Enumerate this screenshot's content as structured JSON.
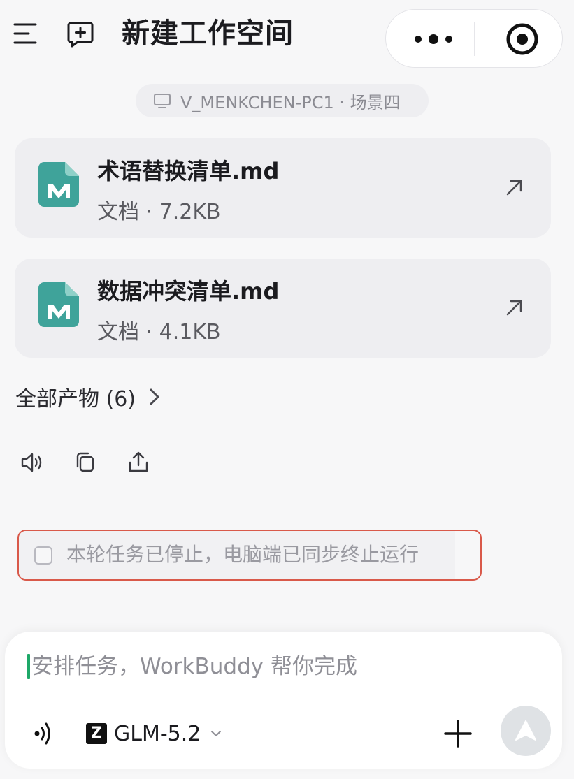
{
  "header": {
    "title": "新建工作空间",
    "menu_icon": "menu-icon",
    "new_icon": "new-chat-icon",
    "more_icon": "more-dots-icon",
    "record_icon": "record-target-icon"
  },
  "device_chip": {
    "label": "V_MENKCHEN-PC1 · 场景四",
    "icon": "monitor-icon"
  },
  "files": [
    {
      "name": "术语替换清单.md",
      "meta": "文档 · 7.2KB",
      "icon": "markdown-file-icon",
      "action_icon": "open-external-icon"
    },
    {
      "name": "数据冲突清单.md",
      "meta": "文档 · 4.1KB",
      "icon": "markdown-file-icon",
      "action_icon": "open-external-icon"
    }
  ],
  "all_products": {
    "label": "全部产物 (6)",
    "icon": "chevron-right-icon"
  },
  "message_actions": [
    {
      "icon": "speaker-icon"
    },
    {
      "icon": "copy-icon"
    },
    {
      "icon": "share-icon"
    }
  ],
  "notice": {
    "text": "本轮任务已停止，电脑端已同步终止运行",
    "checked": false
  },
  "composer": {
    "placeholder": "安排任务，WorkBuddy 帮你完成",
    "model_label": "GLM-5.2",
    "model_logo_letter": "Z",
    "voice_icon": "voice-wave-icon",
    "add_icon": "plus-icon",
    "send_icon": "send-arrow-icon"
  },
  "colors": {
    "accent_green": "#1ea868",
    "file_icon_teal": "#3fa39a",
    "notice_border": "#d9594a",
    "send_disabled": "#dfe2e5"
  }
}
